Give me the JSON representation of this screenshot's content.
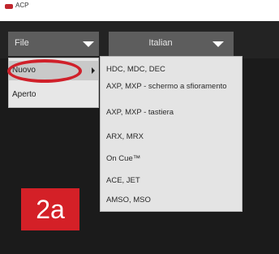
{
  "window": {
    "title": "ACP"
  },
  "colors": {
    "accent": "#d42027",
    "background": "#1b1b1b",
    "dropdown": "#5d5d5d",
    "menu": "#e4e4e4"
  },
  "toolbar": {
    "file_dropdown": {
      "label": "File",
      "icon": "chevron-down-icon"
    },
    "language_dropdown": {
      "label": "Italian",
      "icon": "chevron-down-icon"
    }
  },
  "file_menu": {
    "items": [
      {
        "label": "Nuovo",
        "selected": true,
        "has_submenu": true
      },
      {
        "label": "Aperto",
        "selected": false,
        "has_submenu": false
      }
    ]
  },
  "submenu": {
    "items": [
      {
        "label": "HDC, MDC, DEC"
      },
      {
        "label": "AXP, MXP - schermo a sfioramento"
      },
      {
        "label": "AXP, MXP - tastiera"
      },
      {
        "label": "ARX, MRX"
      },
      {
        "label": "On Cue™"
      },
      {
        "label": "ACE, JET"
      },
      {
        "label": "AMSO, MSO"
      }
    ]
  },
  "annotation": {
    "step_label": "2a"
  }
}
